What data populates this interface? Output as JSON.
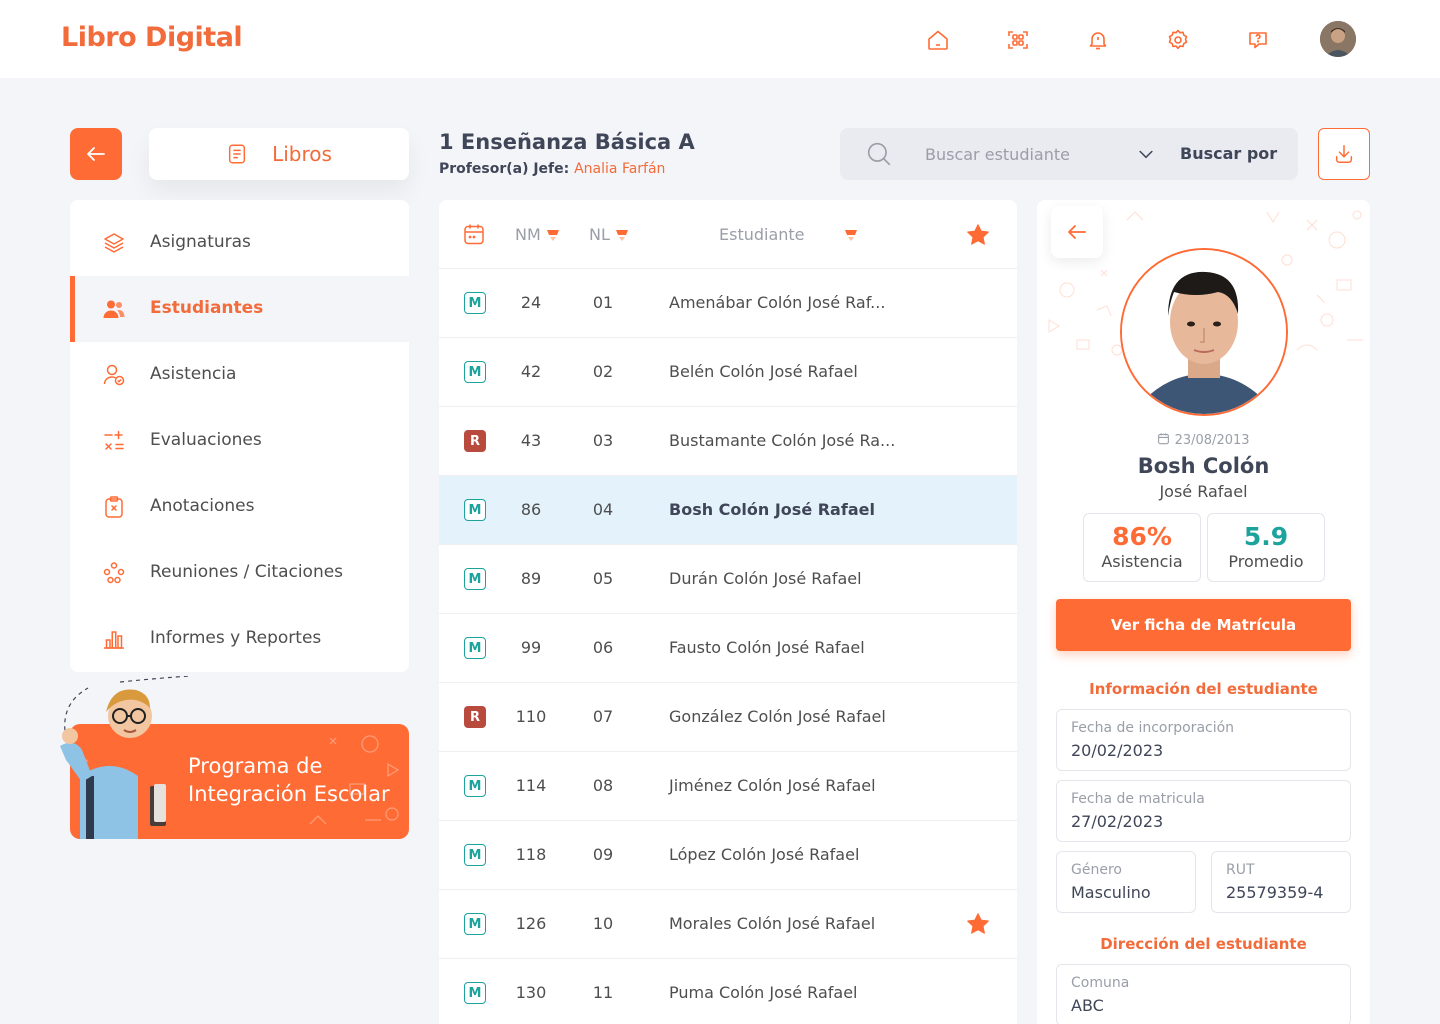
{
  "app": {
    "title": "Libro Digital"
  },
  "topbar": {
    "icons": [
      "home-icon",
      "qr-scan-icon",
      "bell-icon",
      "gear-icon",
      "help-chat-icon"
    ]
  },
  "colors": {
    "accent": "#FF6B35",
    "badge_m": "#1BA39C",
    "badge_r": "#B94A3E",
    "selected_row": "#E3F2FB"
  },
  "nav": {
    "libros_label": "Libros",
    "items": [
      {
        "label": "Asignaturas",
        "icon": "layers-icon"
      },
      {
        "label": "Estudiantes",
        "icon": "users-icon",
        "active": true
      },
      {
        "label": "Asistencia",
        "icon": "user-check-icon"
      },
      {
        "label": "Evaluaciones",
        "icon": "calculator-icon"
      },
      {
        "label": "Anotaciones",
        "icon": "clipboard-x-icon"
      },
      {
        "label": "Reuniones / Citaciones",
        "icon": "group-icon"
      },
      {
        "label": "Informes y Reportes",
        "icon": "bar-chart-icon"
      }
    ]
  },
  "promo": {
    "line1": "Programa de",
    "line2": "Integración Escolar"
  },
  "course": {
    "title": "1 Enseñanza Básica A",
    "prof_label": "Profesor(a) Jefe:",
    "prof_name": "Analia Farfán"
  },
  "search": {
    "placeholder": "Buscar estudiante",
    "filter_label": "Buscar por"
  },
  "table": {
    "headers": {
      "nm": "NM",
      "nl": "NL",
      "student": "Estudiante"
    },
    "rows": [
      {
        "badge": "M",
        "nm": "24",
        "nl": "01",
        "name": "Amenábar Colón José Raf...",
        "star": false
      },
      {
        "badge": "M",
        "nm": "42",
        "nl": "02",
        "name": "Belén Colón José Rafael",
        "star": false
      },
      {
        "badge": "R",
        "nm": "43",
        "nl": "03",
        "name": "Bustamante Colón José Ra...",
        "star": false
      },
      {
        "badge": "M",
        "nm": "86",
        "nl": "04",
        "name": "Bosh Colón José Rafael",
        "star": false,
        "selected": true
      },
      {
        "badge": "M",
        "nm": "89",
        "nl": "05",
        "name": "Durán Colón José Rafael",
        "star": false
      },
      {
        "badge": "M",
        "nm": "99",
        "nl": "06",
        "name": "Fausto Colón José Rafael",
        "star": false
      },
      {
        "badge": "R",
        "nm": "110",
        "nl": "07",
        "name": "González Colón José Rafael",
        "star": false
      },
      {
        "badge": "M",
        "nm": "114",
        "nl": "08",
        "name": "Jiménez Colón José Rafael",
        "star": false
      },
      {
        "badge": "M",
        "nm": "118",
        "nl": "09",
        "name": "López Colón José Rafael",
        "star": false
      },
      {
        "badge": "M",
        "nm": "126",
        "nl": "10",
        "name": "Morales Colón José Rafael",
        "star": true
      },
      {
        "badge": "M",
        "nm": "130",
        "nl": "11",
        "name": "Puma Colón José Rafael",
        "star": false
      }
    ]
  },
  "profile": {
    "dob": "23/08/2013",
    "surname": "Bosh Colón",
    "given": "José Rafael",
    "attendance_value": "86%",
    "attendance_label": "Asistencia",
    "average_value": "5.9",
    "average_label": "Promedio",
    "ficha_button": "Ver ficha de Matrícula",
    "info_title": "Información del estudiante",
    "fields": {
      "incorporation_label": "Fecha de incorporación",
      "incorporation_value": "20/02/2023",
      "enrollment_label": "Fecha de matricula",
      "enrollment_value": "27/02/2023",
      "gender_label": "Género",
      "gender_value": "Masculino",
      "rut_label": "RUT",
      "rut_value": "25579359-4"
    },
    "address_title": "Dirección del estudiante",
    "address": {
      "comuna_label": "Comuna",
      "comuna_value": "ABC"
    }
  }
}
